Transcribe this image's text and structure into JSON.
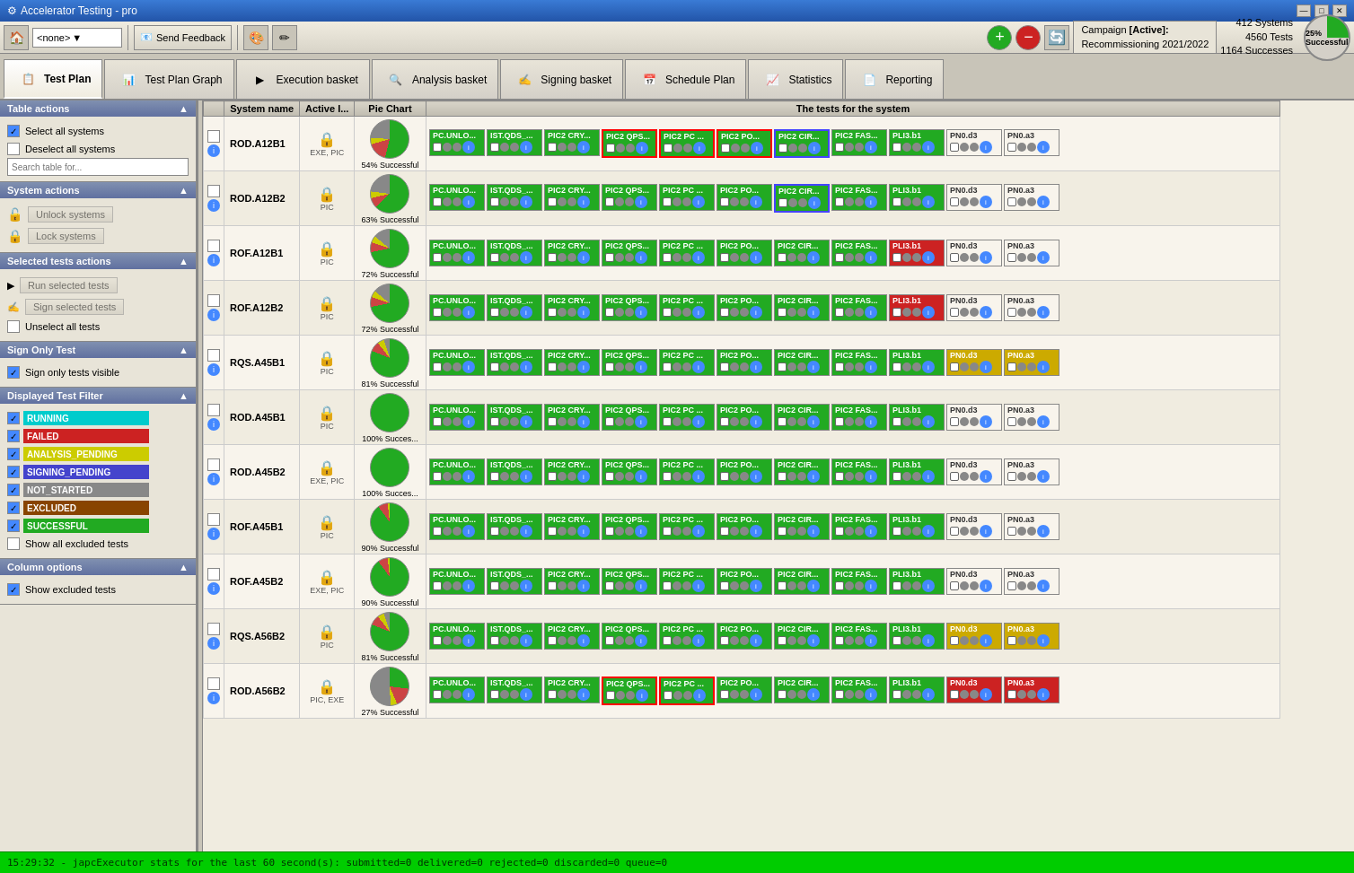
{
  "titleBar": {
    "title": "Accelerator Testing - pro",
    "icon": "⚙"
  },
  "toolbar": {
    "dropdown": "<none>",
    "sendFeedback": "Send Feedback"
  },
  "campaign": {
    "label": "Campaign",
    "name": "[Active]:",
    "description": "Recommissioning 2021/2022",
    "systems": "412 Systems",
    "tests": "4560 Tests",
    "successes": "1164 Successes",
    "successPct": "25% Successful"
  },
  "navTabs": [
    {
      "id": "test-plan",
      "label": "Test Plan",
      "active": true
    },
    {
      "id": "test-plan-graph",
      "label": "Test Plan Graph",
      "active": false
    },
    {
      "id": "execution-basket",
      "label": "Execution basket",
      "active": false
    },
    {
      "id": "analysis-basket",
      "label": "Analysis basket",
      "active": false
    },
    {
      "id": "signing-basket",
      "label": "Signing basket",
      "active": false
    },
    {
      "id": "schedule-plan",
      "label": "Schedule Plan",
      "active": false
    },
    {
      "id": "statistics",
      "label": "Statistics",
      "active": false
    },
    {
      "id": "reporting",
      "label": "Reporting",
      "active": false
    }
  ],
  "leftPanel": {
    "tableActions": {
      "title": "Table actions",
      "selectAll": "Select all systems",
      "deselectAll": "Deselect all systems",
      "searchPlaceholder": "Search table for..."
    },
    "systemActions": {
      "title": "System actions",
      "unlockSystems": "Unlock systems",
      "lockSystems": "Lock systems"
    },
    "selectedTestsActions": {
      "title": "Selected tests actions",
      "runSelected": "Run selected tests",
      "signSelected": "Sign selected tests",
      "unselectAll": "Unselect all tests"
    },
    "signOnlyTest": {
      "title": "Sign Only Test",
      "label": "Sign only tests visible",
      "checked": true
    },
    "displayedTestFilter": {
      "title": "Displayed Test Filter",
      "filters": [
        {
          "label": "RUNNING",
          "color": "#00cccc",
          "checked": true
        },
        {
          "label": "FAILED",
          "color": "#cc2222",
          "checked": true
        },
        {
          "label": "ANALYSIS_PENDING",
          "color": "#cccc00",
          "checked": true
        },
        {
          "label": "SIGNING_PENDING",
          "color": "#4444cc",
          "checked": true
        },
        {
          "label": "NOT_STARTED",
          "color": "#888888",
          "checked": true
        },
        {
          "label": "EXCLUDED",
          "color": "#884400",
          "checked": true
        },
        {
          "label": "SUCCESSFUL",
          "color": "#22aa22",
          "checked": true
        }
      ],
      "showAllExcluded": "Show all excluded tests"
    },
    "columnOptions": {
      "title": "Column options",
      "showExcluded": "Show excluded tests"
    }
  },
  "tableHeaders": [
    "System name",
    "Active I...",
    "Pie Chart",
    "The tests for the system"
  ],
  "rows": [
    {
      "system": "ROD.A12B1",
      "badge": "EXE, PIC",
      "pie": "54% Successful",
      "pieColor": "54"
    },
    {
      "system": "ROD.A12B2",
      "badge": "PIC",
      "pie": "63% Successful",
      "pieColor": "63"
    },
    {
      "system": "ROF.A12B1",
      "badge": "PIC",
      "pie": "72% Successful",
      "pieColor": "72"
    },
    {
      "system": "ROF.A12B2",
      "badge": "PIC",
      "pie": "72% Successful",
      "pieColor": "72"
    },
    {
      "system": "RQS.A45B1",
      "badge": "PIC",
      "pie": "81% Successful",
      "pieColor": "81"
    },
    {
      "system": "ROD.A45B1",
      "badge": "PIC",
      "pie": "100% Succes...",
      "pieColor": "100"
    },
    {
      "system": "ROD.A45B2",
      "badge": "EXE, PIC",
      "pie": "100% Succes...",
      "pieColor": "100"
    },
    {
      "system": "ROF.A45B1",
      "badge": "PIC",
      "pie": "90% Successful",
      "pieColor": "90"
    },
    {
      "system": "ROF.A45B2",
      "badge": "EXE, PIC",
      "pie": "90% Successful",
      "pieColor": "90"
    },
    {
      "system": "RQS.A56B2",
      "badge": "PIC",
      "pie": "81% Successful",
      "pieColor": "81"
    },
    {
      "system": "ROD.A56B2",
      "badge": "PIC, EXE",
      "pie": "27% Successful",
      "pieColor": "27"
    }
  ],
  "statusBar": {
    "text": "15:29:32 - japcExecutor stats for the last 60 second(s): submitted=0 delivered=0 rejected=0 discarded=0 queue=0"
  }
}
